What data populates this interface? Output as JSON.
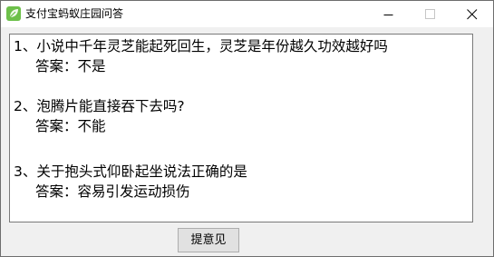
{
  "window": {
    "title": "支付宝蚂蚁庄园问答",
    "icon": "app-leaf-icon",
    "controls": [
      "minimize-icon",
      "maximize-icon",
      "close-icon"
    ]
  },
  "qa": [
    {
      "question": "1、小说中千年灵芝能起死回生，灵芝是年份越久功效越好吗",
      "answer": "答案：不是"
    },
    {
      "question": "2、泡腾片能直接吞下去吗?",
      "answer": "答案：不能"
    },
    {
      "question": "3、关于抱头式仰卧起坐说法正确的是",
      "answer": "答案：容易引发运动损伤"
    }
  ],
  "footer": {
    "submit_label": "提意见"
  },
  "colors": {
    "window_bg": "#f0f0f0",
    "titlebar_bg": "#ffffff",
    "icon_green": "#6dc04a",
    "button_bg": "#e1e1e1"
  }
}
